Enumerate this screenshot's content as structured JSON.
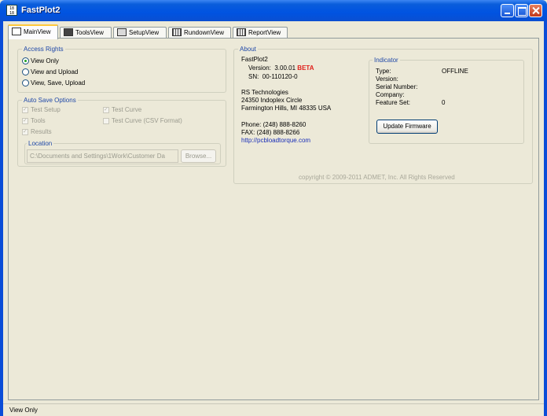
{
  "window": {
    "title": "FastPlot2",
    "app_icon_text": "18 18"
  },
  "tabs": [
    {
      "label": "MainView",
      "icon": "app-icon",
      "active": true
    },
    {
      "label": "ToolsView",
      "icon": "tools-icon",
      "active": false
    },
    {
      "label": "SetupView",
      "icon": "setup-icon",
      "active": false
    },
    {
      "label": "RundownView",
      "icon": "rundown-icon",
      "active": false
    },
    {
      "label": "ReportView",
      "icon": "report-icon",
      "active": false
    }
  ],
  "access_rights": {
    "title": "Access Rights",
    "options": [
      {
        "label": "View Only",
        "selected": true
      },
      {
        "label": "View and Upload",
        "selected": false
      },
      {
        "label": "View, Save, Upload",
        "selected": false
      }
    ]
  },
  "auto_save": {
    "title": "Auto Save Options",
    "test_setup": {
      "label": "Test Setup",
      "checked": true
    },
    "tools": {
      "label": "Tools",
      "checked": true
    },
    "results": {
      "label": "Results",
      "checked": true
    },
    "test_curve": {
      "label": "Test Curve",
      "checked": true
    },
    "test_curve_csv": {
      "label": "Test Curve (CSV Format)",
      "checked": false
    },
    "location": {
      "title": "Location",
      "path": "C:\\Documents and Settings\\1Work\\Customer Da",
      "browse_label": "Browse..."
    }
  },
  "about": {
    "title": "About",
    "app_name": "FastPlot2",
    "version_label": "Version:",
    "version_number": "3.00.01",
    "version_tag": "BETA",
    "sn_label": "SN:",
    "sn_value": "00-110120-0",
    "company": "RS Technologies",
    "address1": "24350 Indoplex Circle",
    "address2": "Farmington Hills, MI 48335 USA",
    "phone": "Phone: (248) 888-8260",
    "fax": "FAX: (248) 888-8266",
    "website": "http://pcbloadtorque.com",
    "copyright": "copyright © 2009-2011 ADMET, Inc. All Rights Reserved"
  },
  "indicator": {
    "title": "Indicator",
    "type_label": "Type:",
    "type_value": "OFFLINE",
    "version_label": "Version:",
    "serial_label": "Serial Number:",
    "company_label": "Company:",
    "feature_label": "Feature Set:",
    "feature_value": "0",
    "update_button": "Update Firmware"
  },
  "status": {
    "text": "View Only"
  }
}
